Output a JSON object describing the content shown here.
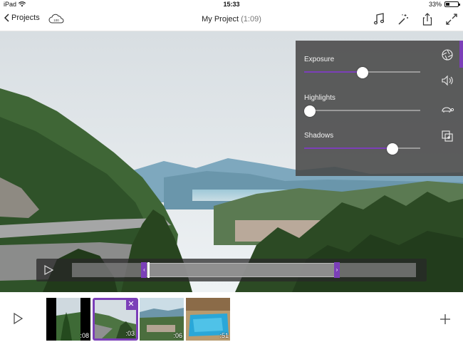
{
  "status_bar": {
    "device": "iPad",
    "time": "15:33",
    "battery": "33%",
    "battery_level": 0.33
  },
  "nav": {
    "back_label": "Projects",
    "cloud_text": "100",
    "title": "My Project",
    "duration": "(1:09)",
    "icons": [
      "music-icon",
      "magic-wand-icon",
      "share-icon",
      "fullscreen-icon"
    ]
  },
  "adjust_panel": {
    "sliders": [
      {
        "label": "Exposure",
        "value": 0.5
      },
      {
        "label": "Highlights",
        "value": 0.05
      },
      {
        "label": "Shadows",
        "value": 0.76
      }
    ],
    "tools": [
      "aperture-icon",
      "volume-icon",
      "turtle-speed-icon",
      "crop-add-icon"
    ],
    "accent": "#7b3fb8"
  },
  "timeline": {
    "selection_start": 0.21,
    "selection_end": 0.77,
    "playhead": 0.22
  },
  "clips": [
    {
      "duration": ":08",
      "selected": false
    },
    {
      "duration": ":03",
      "selected": true
    },
    {
      "duration": ":06",
      "selected": false
    },
    {
      "duration": ":51",
      "selected": false
    }
  ]
}
